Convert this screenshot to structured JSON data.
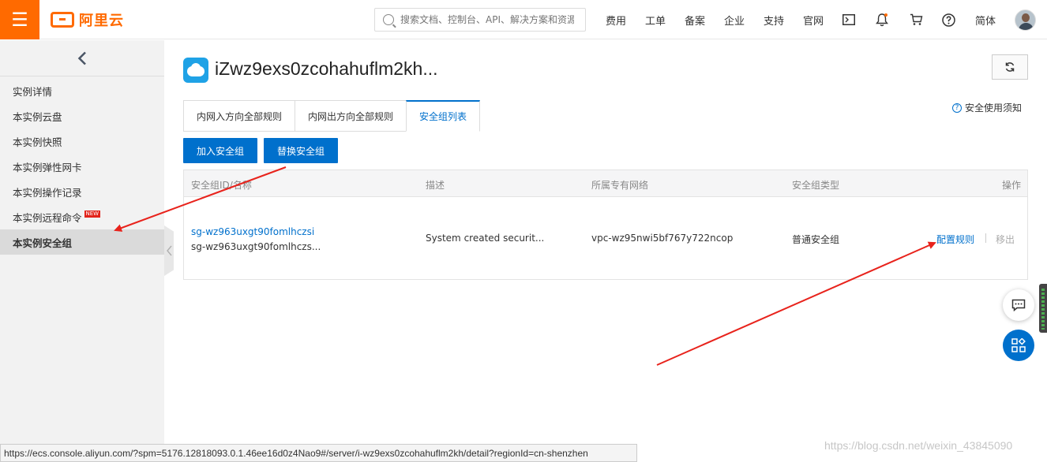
{
  "header": {
    "logo_text": "阿里云",
    "search_placeholder": "搜索文档、控制台、API、解决方案和资源",
    "nav": [
      "费用",
      "工单",
      "备案",
      "企业",
      "支持",
      "官网"
    ],
    "lang": "简体"
  },
  "sidebar": {
    "items": [
      {
        "label": "实例详情"
      },
      {
        "label": "本实例云盘"
      },
      {
        "label": "本实例快照"
      },
      {
        "label": "本实例弹性网卡"
      },
      {
        "label": "本实例操作记录"
      },
      {
        "label": "本实例远程命令",
        "badge": "NEW"
      },
      {
        "label": "本实例安全组",
        "active": true
      }
    ]
  },
  "page": {
    "title": "iZwz9exs0zcohahuflm2kh...",
    "tabs": [
      "内网入方向全部规则",
      "内网出方向全部规则",
      "安全组列表"
    ],
    "active_tab": "安全组列表",
    "help_link": "安全使用须知",
    "buttons": {
      "join": "加入安全组",
      "replace": "替换安全组"
    }
  },
  "table": {
    "columns": [
      "安全组ID/名称",
      "描述",
      "所属专有网络",
      "安全组类型",
      "操作"
    ],
    "rows": [
      {
        "id": "sg-wz963uxgt90fomlhczsi",
        "name": "sg-wz963uxgt90fomlhczs...",
        "description": "System created securit...",
        "vpc": "vpc-wz95nwi5bf767y722ncop",
        "type": "普通安全组",
        "actions": [
          "配置规则",
          "移出"
        ]
      }
    ]
  },
  "statusbar": {
    "url": "https://ecs.console.aliyun.com/?spm=5176.12818093.0.1.46ee16d0z4Nao9#/server/i-wz9exs0zcohahuflm2kh/detail?regionId=cn-shenzhen"
  },
  "watermark": "https://blog.csdn.net/weixin_43845090",
  "colors": {
    "brand": "#ff6a00",
    "primary": "#0070cc",
    "annotation_arrow": "#e8231c"
  }
}
